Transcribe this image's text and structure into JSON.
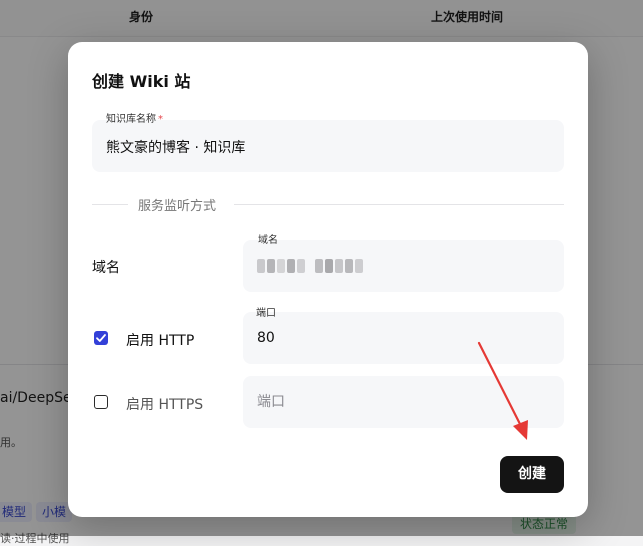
{
  "background": {
    "table_headers": [
      "身份",
      "上次使用时间"
    ],
    "model_name_fragment": "ai/DeepSee",
    "desc_fragment": "用。",
    "tags": [
      "模型",
      "小模"
    ],
    "status": "状态正常",
    "footer_fragment": "读·过程中使用"
  },
  "modal": {
    "title": "创建 Wiki 站",
    "kb_name": {
      "label": "知识库名称",
      "required_mark": "*",
      "value": "熊文豪的博客 · 知识库"
    },
    "section_title": "服务监听方式",
    "domain": {
      "row_label": "域名",
      "field_label": "域名",
      "value_redacted": true
    },
    "http": {
      "checked": true,
      "label": "启用 HTTP",
      "port_label": "端口",
      "port_value": "80"
    },
    "https": {
      "checked": false,
      "label": "启用 HTTPS",
      "port_placeholder": "端口"
    },
    "create_button": "创建"
  },
  "colors": {
    "accent": "#3340d8",
    "button": "#141414",
    "annotation_arrow": "#e53935"
  }
}
